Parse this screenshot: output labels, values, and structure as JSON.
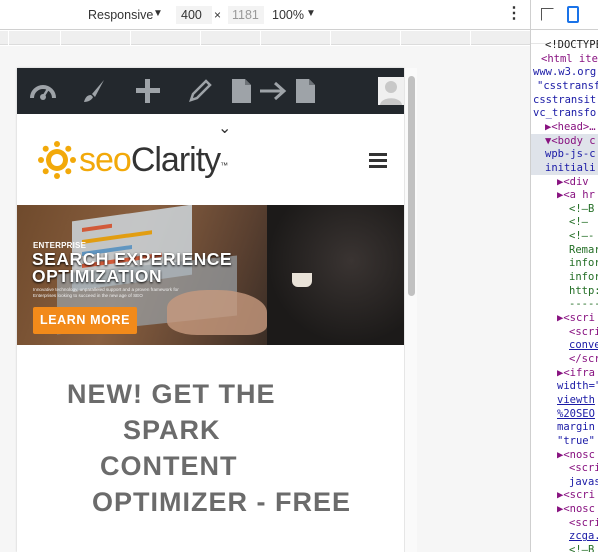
{
  "devbar": {
    "preset": "Responsive",
    "width": "400",
    "times": "×",
    "height": "1181",
    "zoom": "100%",
    "preset_caret": "▼",
    "zoom_caret": "▼",
    "more": "⋮"
  },
  "adminbar": {
    "icons": [
      "dashboard-icon",
      "brush-icon",
      "plus-icon",
      "pencil-icon",
      "page-icon",
      "arrow-right-icon",
      "page-icon",
      "user-avatar-icon"
    ]
  },
  "site": {
    "chevron": "⌄",
    "logo_seo": "seo",
    "logo_clarity": "Clarity",
    "logo_tm": "™",
    "hero": {
      "kicker": "ENTERPRISE",
      "title_line1": "SEARCH EXPERIENCE",
      "title_line2": "OPTIMIZATION",
      "blurb": "Innovative technology, unparalleled support and a proven framework for Enterprises looking to succeed in the new age of SEO",
      "cta": "LEARN MORE"
    },
    "headline": {
      "line1": "NEW! GET THE",
      "line2": "SPARK",
      "line3": "CONTENT",
      "line4": "OPTIMIZER - FREE"
    }
  },
  "devtools": {
    "lines": [
      {
        "text": "<!DOCTYPE",
        "cls": "blk"
      },
      {
        "text": "<html ite",
        "cls": "tag"
      },
      {
        "text": "www.w3.org",
        "cls": "str"
      },
      {
        "text": "\"csstransf",
        "cls": "str"
      },
      {
        "text": "csstransit",
        "cls": "str"
      },
      {
        "text": "vc_transfo",
        "cls": "str"
      },
      {
        "text": "▶<head>…",
        "cls": "tag"
      },
      {
        "text": "▼<body c",
        "cls": "tag"
      },
      {
        "text": "wpb-js-c",
        "cls": "str"
      },
      {
        "text": "initiali",
        "cls": "str"
      },
      {
        "text": "▶<div",
        "cls": "tag"
      },
      {
        "text": "▶<a hr",
        "cls": "tag"
      },
      {
        "text": "<!—B",
        "cls": "cm"
      },
      {
        "text": "<!— ",
        "cls": "cm"
      },
      {
        "text": "<!—-",
        "cls": "cm"
      },
      {
        "text": "Remar",
        "cls": "cm"
      },
      {
        "text": "infor",
        "cls": "cm"
      },
      {
        "text": "infor",
        "cls": "cm"
      },
      {
        "text": "http:",
        "cls": "cm"
      },
      {
        "text": "-----",
        "cls": "cm"
      },
      {
        "text": "▶<scri",
        "cls": "tag"
      },
      {
        "text": "<scri",
        "cls": "tag"
      },
      {
        "text": "conve",
        "cls": "lnk"
      },
      {
        "text": "</scr",
        "cls": "tag"
      },
      {
        "text": "▶<ifra",
        "cls": "tag"
      },
      {
        "text": "width=\"",
        "cls": "str"
      },
      {
        "text": "viewth",
        "cls": "lnk"
      },
      {
        "text": "%20SEO",
        "cls": "lnk"
      },
      {
        "text": "margin",
        "cls": "str"
      },
      {
        "text": "\"true\"",
        "cls": "str"
      },
      {
        "text": "▶<nosc",
        "cls": "tag"
      },
      {
        "text": "<scri",
        "cls": "tag"
      },
      {
        "text": "javas",
        "cls": "str"
      },
      {
        "text": "▶<scri",
        "cls": "tag"
      },
      {
        "text": "▶<nosc",
        "cls": "tag"
      },
      {
        "text": "<scri",
        "cls": "tag"
      },
      {
        "text": "zcga.",
        "cls": "lnk"
      },
      {
        "text": "<!—B",
        "cls": "cm"
      }
    ]
  }
}
